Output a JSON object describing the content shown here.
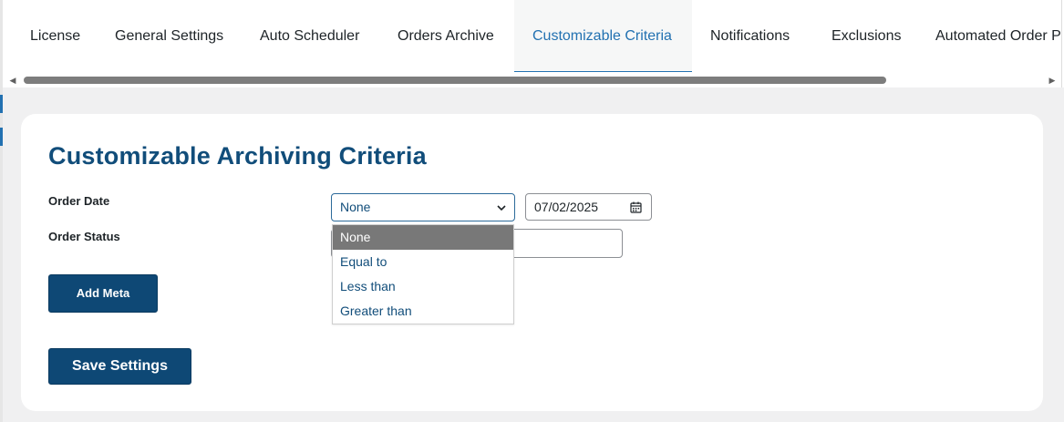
{
  "tabs": [
    {
      "label": "License",
      "active": false
    },
    {
      "label": "General Settings",
      "active": false
    },
    {
      "label": "Auto Scheduler",
      "active": false
    },
    {
      "label": "Orders Archive",
      "active": false
    },
    {
      "label": "Customizable Criteria",
      "active": true
    },
    {
      "label": "Notifications",
      "active": false
    },
    {
      "label": "Exclusions",
      "active": false
    },
    {
      "label": "Automated Order P",
      "active": false
    }
  ],
  "page": {
    "title": "Customizable Archiving Criteria"
  },
  "form": {
    "order_date_label": "Order Date",
    "order_status_label": "Order Status",
    "date_operator_value": "None",
    "date_value": "07/02/2025",
    "date_operator_options": [
      "None",
      "Equal to",
      "Less than",
      "Greater than"
    ],
    "selected_option": "None"
  },
  "buttons": {
    "add_meta": "Add Meta",
    "save_settings": "Save Settings"
  },
  "icons": {
    "select_arrow": "chevron-down-icon",
    "date_picker": "calendar-icon",
    "scroll_left": "scroll-left-arrow-icon",
    "scroll_right": "scroll-right-arrow-icon"
  },
  "colors": {
    "accent": "#2271b1",
    "title": "#114d7a",
    "button": "#0e4875",
    "selected_option_bg": "#787878"
  }
}
